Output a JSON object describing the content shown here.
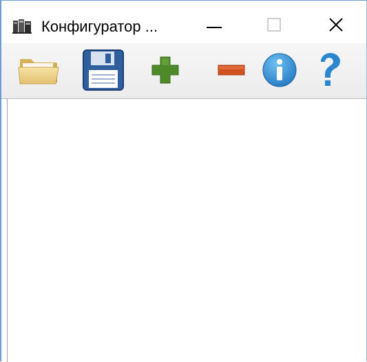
{
  "window": {
    "title": "Конфигуратор ...",
    "controls": {
      "minimize": "minimize-icon",
      "maximize": "maximize-icon",
      "close": "close-icon"
    }
  },
  "toolbar": {
    "items": [
      {
        "name": "open-button",
        "icon": "folder-open-icon"
      },
      {
        "name": "save-button",
        "icon": "floppy-disk-icon"
      },
      {
        "name": "add-button",
        "icon": "plus-icon"
      },
      {
        "name": "remove-button",
        "icon": "minus-icon"
      },
      {
        "name": "info-button",
        "icon": "info-icon"
      },
      {
        "name": "help-button",
        "icon": "question-icon"
      }
    ]
  },
  "colors": {
    "title_border": "#6a9bd6",
    "folder": "#e8c977",
    "floppy": "#2f5f9f",
    "plus": "#4f8a2a",
    "minus": "#d2521f",
    "info": "#2a86cf",
    "help": "#2a86cf"
  }
}
